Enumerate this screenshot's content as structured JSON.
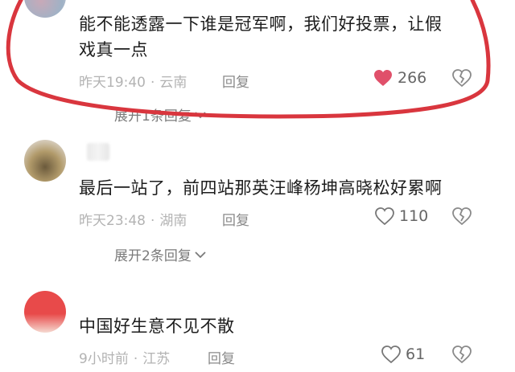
{
  "comments": [
    {
      "text_line1": "能不能透露一下谁是冠军啊，我们好投票，让假",
      "text_line2": "戏真一点",
      "time": "昨天19:40",
      "location": "云南",
      "reply_label": "回复",
      "likes": "266",
      "liked": true,
      "expand_label": "展开1条回复"
    },
    {
      "text_line1": "最后一站了，前四站那英汪峰杨坤高晓松好累啊",
      "time": "昨天23:48",
      "location": "湖南",
      "reply_label": "回复",
      "likes": "110",
      "liked": false,
      "expand_label": "展开2条回复"
    },
    {
      "text_line1": "中国好生意不见不散",
      "time": "9小时前",
      "location": "江苏",
      "reply_label": "回复",
      "likes": "61",
      "liked": false
    }
  ],
  "colors": {
    "like_active": "#e0506a",
    "annotation_circle": "#d9363e"
  }
}
